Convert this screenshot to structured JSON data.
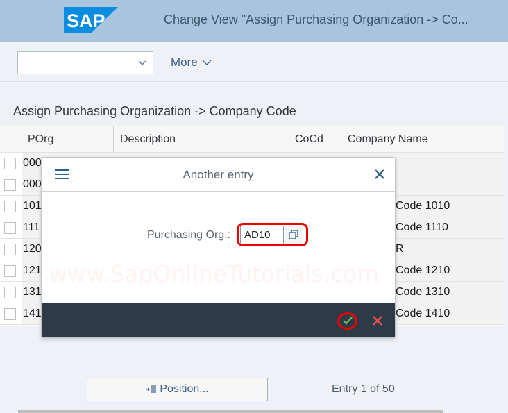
{
  "shell": {
    "logo_text": "SAP",
    "title": "Change View \"Assign Purchasing  Organization -> Co...",
    "brand_color": "#0a8ce0",
    "shell_color": "#a9c4dd"
  },
  "toolbar": {
    "select_value": "",
    "more_label": "More"
  },
  "section": {
    "title": "Assign Purchasing  Organization -> Company Code"
  },
  "table": {
    "columns": [
      "POrg",
      "Description",
      "CoCd",
      "Company Name"
    ],
    "rows": [
      {
        "porg": "000",
        "company_name": ""
      },
      {
        "porg": "000",
        "company_name": ""
      },
      {
        "porg": "101",
        "company_name": "Code 1010"
      },
      {
        "porg": "111",
        "company_name": "Code 1110"
      },
      {
        "porg": "120",
        "company_name": "R"
      },
      {
        "porg": "121",
        "company_name": "Code 1210"
      },
      {
        "porg": "131",
        "company_name": "Code 1310"
      },
      {
        "porg": "141",
        "company_name": "Code 1410"
      }
    ]
  },
  "dialog": {
    "title": "Another entry",
    "field_label": "Purchasing Org.:",
    "field_value": "AD10",
    "watermark": "www.SapOnlineTutorials.com",
    "highlight_color": "#e00000"
  },
  "footer": {
    "position_label": "Position...",
    "entry_count": "Entry 1 of 50"
  }
}
